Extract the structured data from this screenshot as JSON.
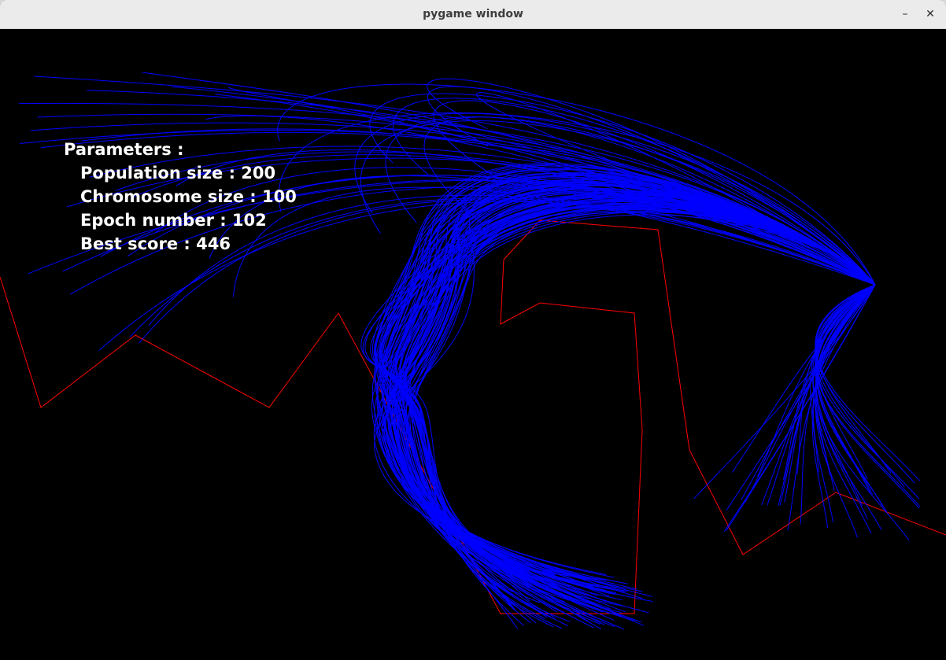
{
  "window": {
    "title": "pygame window",
    "minimize_symbol": "–",
    "close_symbol": "✕"
  },
  "hud": {
    "heading": "Parameters :",
    "population": "Population size : 200",
    "chromosome": "Chromosome size : 100",
    "epoch": "Epoch number : 102",
    "best": "Best score : 446"
  },
  "colors": {
    "background": "#000000",
    "walls": "#ff0000",
    "trajectories": "#0000ff",
    "hud_text": "#ffffff"
  },
  "icons": {
    "minimize": "minimize-icon",
    "close": "close-icon"
  }
}
